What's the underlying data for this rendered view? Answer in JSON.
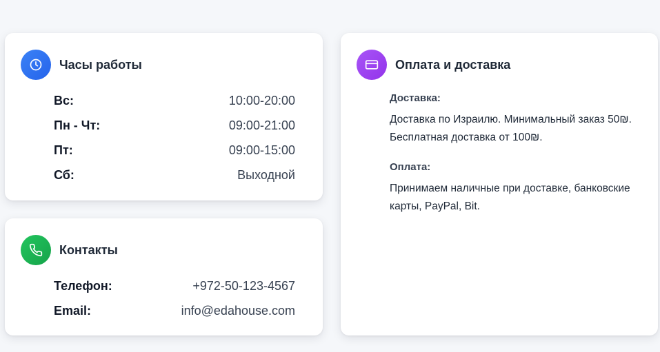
{
  "hours": {
    "title": "Часы работы",
    "icon": "clock-icon",
    "rows": [
      {
        "label": "Вс:",
        "value": "10:00-20:00"
      },
      {
        "label": "Пн - Чт:",
        "value": "09:00-21:00"
      },
      {
        "label": "Пт:",
        "value": "09:00-15:00"
      },
      {
        "label": "Сб:",
        "value": "Выходной"
      }
    ]
  },
  "contacts": {
    "title": "Контакты",
    "icon": "phone-icon",
    "rows": [
      {
        "label": "Телефон:",
        "value": "+972-50-123-4567"
      },
      {
        "label": "Email:",
        "value": "info@edahouse.com"
      }
    ]
  },
  "payment": {
    "title": "Оплата и доставка",
    "icon": "credit-card-icon",
    "delivery_heading": "Доставка:",
    "delivery_text": "Доставка по Израилю. Минимальный заказ 50₪. Бесплатная доставка от 100₪.",
    "payment_heading": "Оплата:",
    "payment_text": "Принимаем наличные при доставке, банковские карты, PayPal, Bit."
  },
  "colors": {
    "hours_icon_bg": "#2563eb",
    "contacts_icon_bg": "#16a34a",
    "payment_icon_bg": "#9333ea",
    "page_bg": "#f5f7fa"
  }
}
